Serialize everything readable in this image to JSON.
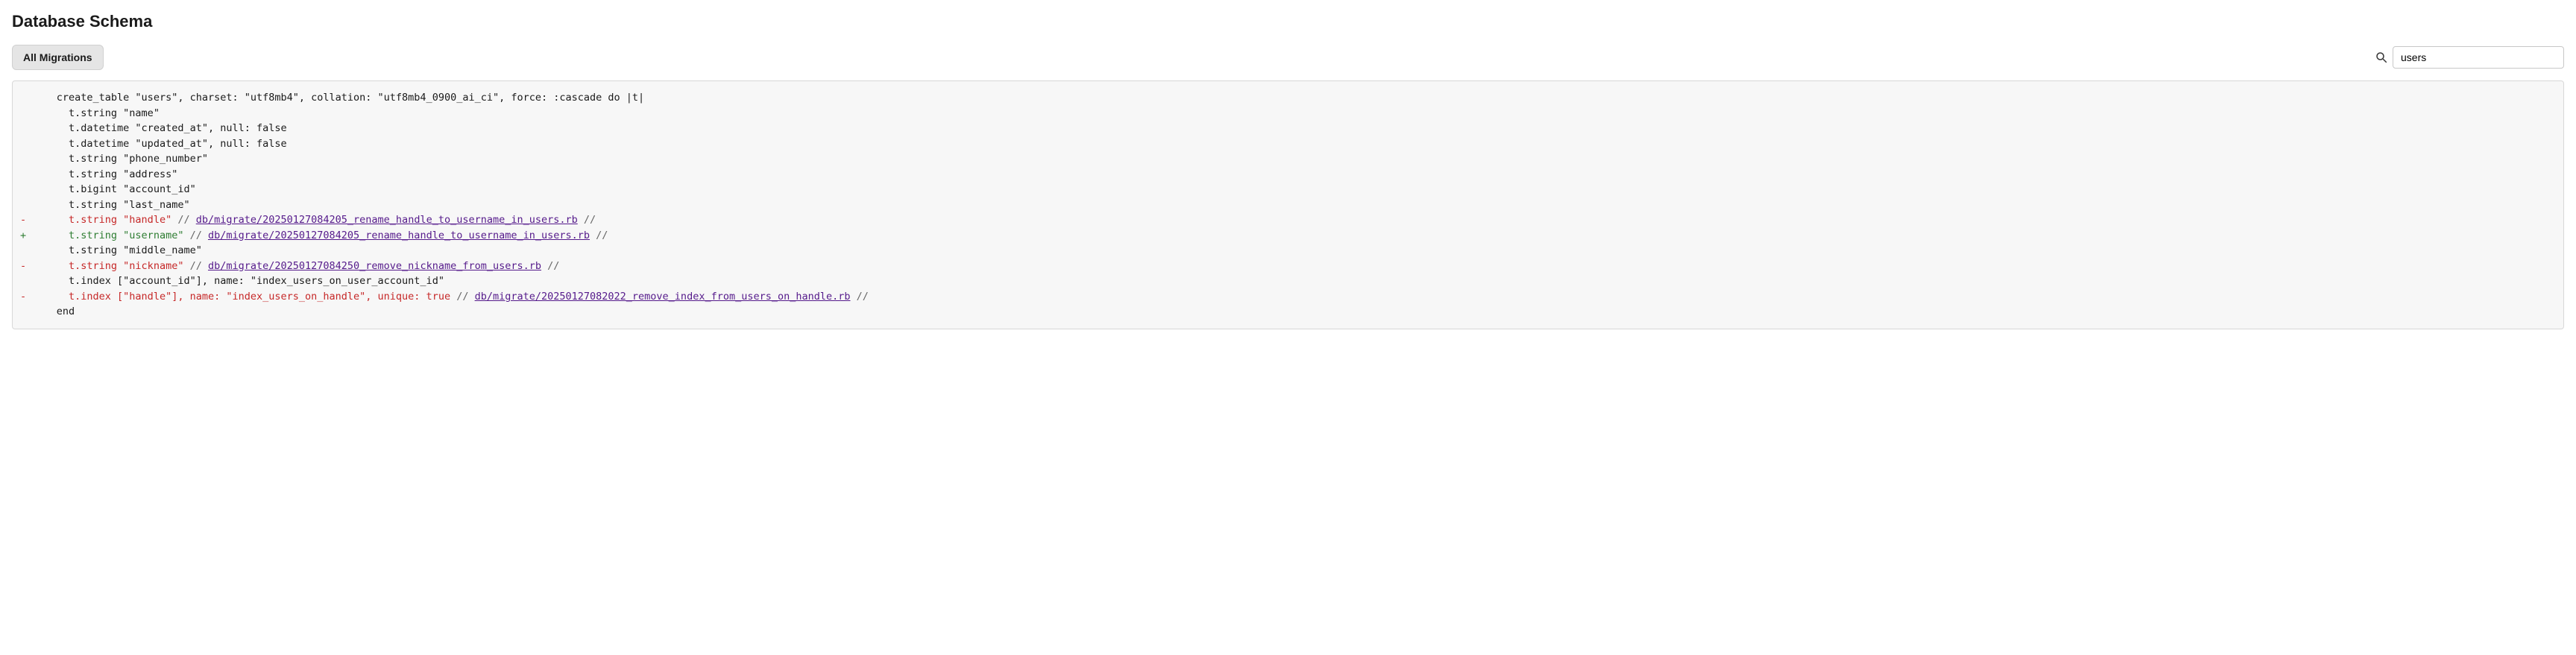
{
  "header": {
    "title": "Database Schema"
  },
  "toolbar": {
    "all_migrations_label": "All Migrations",
    "search_value": "users"
  },
  "schema": {
    "lines": [
      {
        "kind": "ctx",
        "indent": 1,
        "text": "create_table \"users\", charset: \"utf8mb4\", collation: \"utf8mb4_0900_ai_ci\", force: :cascade do |t|"
      },
      {
        "kind": "ctx",
        "indent": 2,
        "text": "t.string \"name\""
      },
      {
        "kind": "ctx",
        "indent": 2,
        "text": "t.datetime \"created_at\", null: false"
      },
      {
        "kind": "ctx",
        "indent": 2,
        "text": "t.datetime \"updated_at\", null: false"
      },
      {
        "kind": "ctx",
        "indent": 2,
        "text": "t.string \"phone_number\""
      },
      {
        "kind": "ctx",
        "indent": 2,
        "text": "t.string \"address\""
      },
      {
        "kind": "ctx",
        "indent": 2,
        "text": "t.bigint \"account_id\""
      },
      {
        "kind": "ctx",
        "indent": 2,
        "text": "t.string \"last_name\""
      },
      {
        "kind": "del",
        "indent": 2,
        "text": "t.string \"handle\"",
        "migration": "db/migrate/20250127084205_rename_handle_to_username_in_users.rb"
      },
      {
        "kind": "add",
        "indent": 2,
        "text": "t.string \"username\"",
        "migration": "db/migrate/20250127084205_rename_handle_to_username_in_users.rb"
      },
      {
        "kind": "ctx",
        "indent": 2,
        "text": "t.string \"middle_name\""
      },
      {
        "kind": "del",
        "indent": 2,
        "text": "t.string \"nickname\"",
        "migration": "db/migrate/20250127084250_remove_nickname_from_users.rb"
      },
      {
        "kind": "ctx",
        "indent": 2,
        "text": "t.index [\"account_id\"], name: \"index_users_on_user_account_id\""
      },
      {
        "kind": "del",
        "indent": 2,
        "text": "t.index [\"handle\"], name: \"index_users_on_handle\", unique: true",
        "migration": "db/migrate/20250127082022_remove_index_from_users_on_handle.rb"
      },
      {
        "kind": "ctx",
        "indent": 1,
        "text": "end"
      }
    ]
  }
}
